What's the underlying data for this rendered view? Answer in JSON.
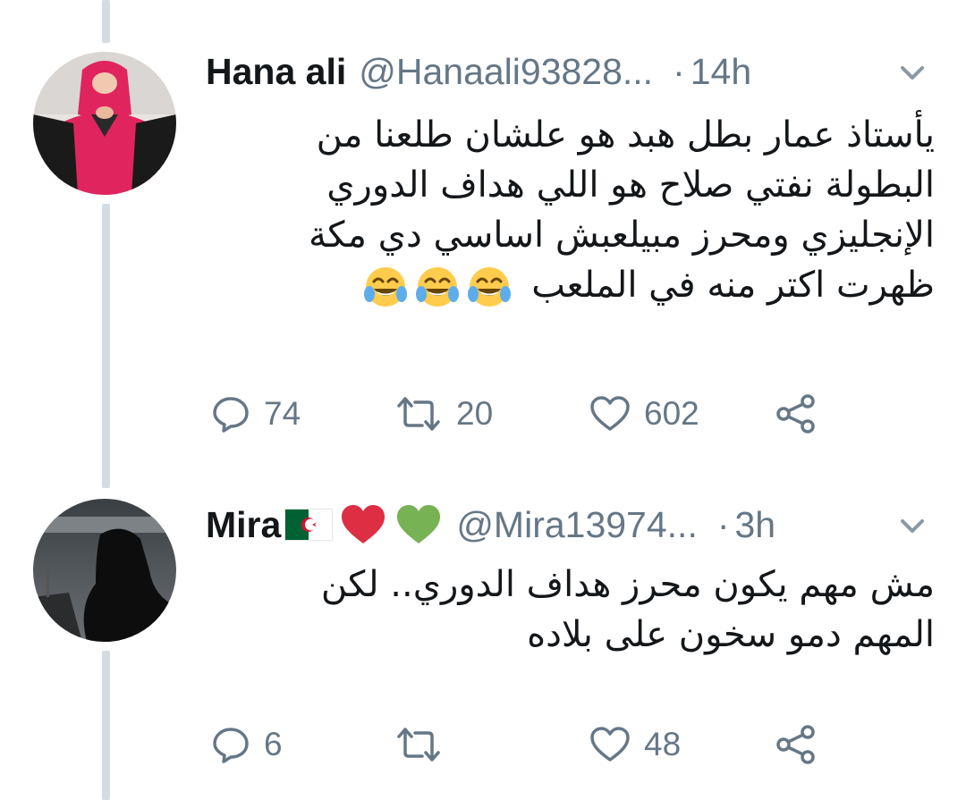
{
  "tweets": [
    {
      "name": "Hana ali",
      "handle": "@Hanaali93828...",
      "dot": "·",
      "time": "14h",
      "text_lines": [
        "يأستاذ عمار بطل هبد هو علشان طلعنا من",
        "البطولة نفتي صلاح هو اللي هداف الدوري",
        "الإنجليزي ومحرز مبيلعبش اساسي دي مكة",
        "ظهرت اكتر منه في الملعب"
      ],
      "emoji": [
        "face-with-tears-of-joy",
        "face-with-tears-of-joy",
        "face-with-tears-of-joy"
      ],
      "replies": "74",
      "retweets": "20",
      "likes": "602"
    },
    {
      "name": "Mira",
      "name_emoji": [
        "algeria-flag",
        "red-heart",
        "green-heart"
      ],
      "handle": "@Mira13974...",
      "dot": "·",
      "time": "3h",
      "text_lines": [
        "مش مهم يكون محرز هداف الدوري.. لكن",
        "المهم دمو سخون على بلاده"
      ],
      "replies": "6",
      "retweets": "",
      "likes": "48"
    }
  ],
  "colors": {
    "text": "#14171a",
    "secondary": "#657786",
    "thread_line": "#d3dce3",
    "red_heart": "#e0245e",
    "green_heart": "#77b255",
    "emoji_yellow": "#ffcc4d",
    "tear_blue": "#5dadec"
  },
  "icons": {
    "reply": "reply-icon",
    "retweet": "retweet-icon",
    "like": "heart-outline-icon",
    "share": "share-icon",
    "menu": "chevron-down-icon"
  }
}
